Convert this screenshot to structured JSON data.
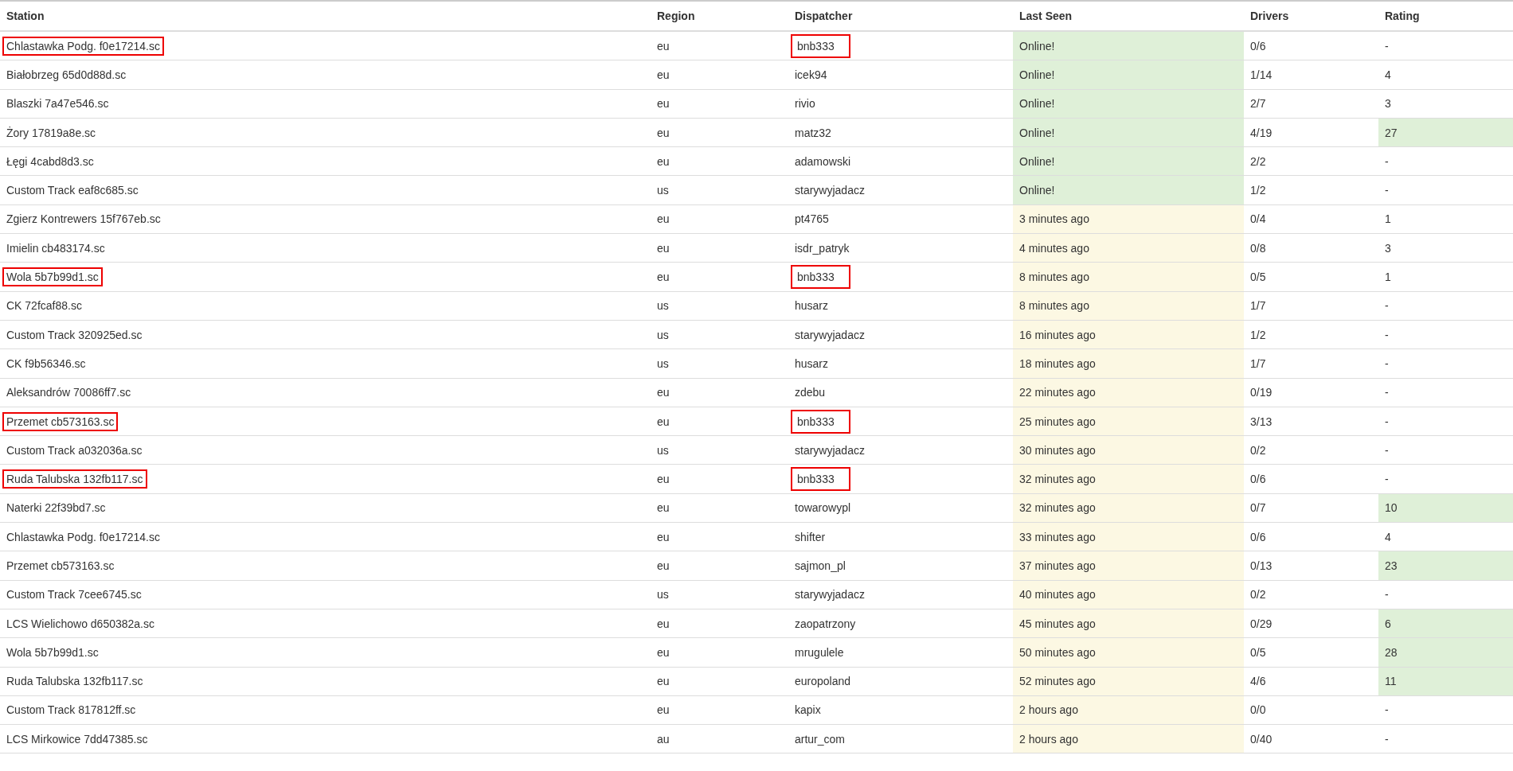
{
  "table": {
    "columns": [
      "Station",
      "Region",
      "Dispatcher",
      "Last Seen",
      "Drivers",
      "Rating"
    ],
    "rows": [
      {
        "station": "Chlastawka Podg. f0e17214.sc",
        "station_marked": true,
        "region": "eu",
        "dispatcher": "bnb333",
        "dispatcher_marked": true,
        "last_seen": "Online!",
        "online": true,
        "drivers": "0/6",
        "rating": "-",
        "rating_highlighted": false
      },
      {
        "station": "Białobrzeg 65d0d88d.sc",
        "station_marked": false,
        "region": "eu",
        "dispatcher": "icek94",
        "dispatcher_marked": false,
        "last_seen": "Online!",
        "online": true,
        "drivers": "1/14",
        "rating": "4",
        "rating_highlighted": false
      },
      {
        "station": "Blaszki 7a47e546.sc",
        "station_marked": false,
        "region": "eu",
        "dispatcher": "rivio",
        "dispatcher_marked": false,
        "last_seen": "Online!",
        "online": true,
        "drivers": "2/7",
        "rating": "3",
        "rating_highlighted": false
      },
      {
        "station": "Żory 17819a8e.sc",
        "station_marked": false,
        "region": "eu",
        "dispatcher": "matz32",
        "dispatcher_marked": false,
        "last_seen": "Online!",
        "online": true,
        "drivers": "4/19",
        "rating": "27",
        "rating_highlighted": true
      },
      {
        "station": "Łęgi 4cabd8d3.sc",
        "station_marked": false,
        "region": "eu",
        "dispatcher": "adamowski",
        "dispatcher_marked": false,
        "last_seen": "Online!",
        "online": true,
        "drivers": "2/2",
        "rating": "-",
        "rating_highlighted": false
      },
      {
        "station": "Custom Track eaf8c685.sc",
        "station_marked": false,
        "region": "us",
        "dispatcher": "starywyjadacz",
        "dispatcher_marked": false,
        "last_seen": "Online!",
        "online": true,
        "drivers": "1/2",
        "rating": "-",
        "rating_highlighted": false
      },
      {
        "station": "Zgierz Kontrewers 15f767eb.sc",
        "station_marked": false,
        "region": "eu",
        "dispatcher": "pt4765",
        "dispatcher_marked": false,
        "last_seen": "3 minutes ago",
        "online": false,
        "drivers": "0/4",
        "rating": "1",
        "rating_highlighted": false
      },
      {
        "station": "Imielin cb483174.sc",
        "station_marked": false,
        "region": "eu",
        "dispatcher": "isdr_patryk",
        "dispatcher_marked": false,
        "last_seen": "4 minutes ago",
        "online": false,
        "drivers": "0/8",
        "rating": "3",
        "rating_highlighted": false
      },
      {
        "station": "Wola 5b7b99d1.sc",
        "station_marked": true,
        "region": "eu",
        "dispatcher": "bnb333",
        "dispatcher_marked": true,
        "last_seen": "8 minutes ago",
        "online": false,
        "drivers": "0/5",
        "rating": "1",
        "rating_highlighted": false
      },
      {
        "station": "CK 72fcaf88.sc",
        "station_marked": false,
        "region": "us",
        "dispatcher": "husarz",
        "dispatcher_marked": false,
        "last_seen": "8 minutes ago",
        "online": false,
        "drivers": "1/7",
        "rating": "-",
        "rating_highlighted": false
      },
      {
        "station": "Custom Track 320925ed.sc",
        "station_marked": false,
        "region": "us",
        "dispatcher": "starywyjadacz",
        "dispatcher_marked": false,
        "last_seen": "16 minutes ago",
        "online": false,
        "drivers": "1/2",
        "rating": "-",
        "rating_highlighted": false
      },
      {
        "station": "CK f9b56346.sc",
        "station_marked": false,
        "region": "us",
        "dispatcher": "husarz",
        "dispatcher_marked": false,
        "last_seen": "18 minutes ago",
        "online": false,
        "drivers": "1/7",
        "rating": "-",
        "rating_highlighted": false
      },
      {
        "station": "Aleksandrów 70086ff7.sc",
        "station_marked": false,
        "region": "eu",
        "dispatcher": "zdebu",
        "dispatcher_marked": false,
        "last_seen": "22 minutes ago",
        "online": false,
        "drivers": "0/19",
        "rating": "-",
        "rating_highlighted": false
      },
      {
        "station": "Przemet cb573163.sc",
        "station_marked": true,
        "region": "eu",
        "dispatcher": "bnb333",
        "dispatcher_marked": true,
        "last_seen": "25 minutes ago",
        "online": false,
        "drivers": "3/13",
        "rating": "-",
        "rating_highlighted": false
      },
      {
        "station": "Custom Track a032036a.sc",
        "station_marked": false,
        "region": "us",
        "dispatcher": "starywyjadacz",
        "dispatcher_marked": false,
        "last_seen": "30 minutes ago",
        "online": false,
        "drivers": "0/2",
        "rating": "-",
        "rating_highlighted": false
      },
      {
        "station": "Ruda Talubska 132fb117.sc",
        "station_marked": true,
        "region": "eu",
        "dispatcher": "bnb333",
        "dispatcher_marked": true,
        "last_seen": "32 minutes ago",
        "online": false,
        "drivers": "0/6",
        "rating": "-",
        "rating_highlighted": false
      },
      {
        "station": "Naterki 22f39bd7.sc",
        "station_marked": false,
        "region": "eu",
        "dispatcher": "towarowypl",
        "dispatcher_marked": false,
        "last_seen": "32 minutes ago",
        "online": false,
        "drivers": "0/7",
        "rating": "10",
        "rating_highlighted": true
      },
      {
        "station": "Chlastawka Podg. f0e17214.sc",
        "station_marked": false,
        "region": "eu",
        "dispatcher": "shifter",
        "dispatcher_marked": false,
        "last_seen": "33 minutes ago",
        "online": false,
        "drivers": "0/6",
        "rating": "4",
        "rating_highlighted": false
      },
      {
        "station": "Przemet cb573163.sc",
        "station_marked": false,
        "region": "eu",
        "dispatcher": "sajmon_pl",
        "dispatcher_marked": false,
        "last_seen": "37 minutes ago",
        "online": false,
        "drivers": "0/13",
        "rating": "23",
        "rating_highlighted": true
      },
      {
        "station": "Custom Track 7cee6745.sc",
        "station_marked": false,
        "region": "us",
        "dispatcher": "starywyjadacz",
        "dispatcher_marked": false,
        "last_seen": "40 minutes ago",
        "online": false,
        "drivers": "0/2",
        "rating": "-",
        "rating_highlighted": false
      },
      {
        "station": "LCS Wielichowo d650382a.sc",
        "station_marked": false,
        "region": "eu",
        "dispatcher": "zaopatrzony",
        "dispatcher_marked": false,
        "last_seen": "45 minutes ago",
        "online": false,
        "drivers": "0/29",
        "rating": "6",
        "rating_highlighted": true
      },
      {
        "station": "Wola 5b7b99d1.sc",
        "station_marked": false,
        "region": "eu",
        "dispatcher": "mrugulele",
        "dispatcher_marked": false,
        "last_seen": "50 minutes ago",
        "online": false,
        "drivers": "0/5",
        "rating": "28",
        "rating_highlighted": true
      },
      {
        "station": "Ruda Talubska 132fb117.sc",
        "station_marked": false,
        "region": "eu",
        "dispatcher": "europoland",
        "dispatcher_marked": false,
        "last_seen": "52 minutes ago",
        "online": false,
        "drivers": "4/6",
        "rating": "11",
        "rating_highlighted": true
      },
      {
        "station": "Custom Track 817812ff.sc",
        "station_marked": false,
        "region": "eu",
        "dispatcher": "kapix",
        "dispatcher_marked": false,
        "last_seen": "2 hours ago",
        "online": false,
        "drivers": "0/0",
        "rating": "-",
        "rating_highlighted": false
      },
      {
        "station": "LCS Mirkowice 7dd47385.sc",
        "station_marked": false,
        "region": "au",
        "dispatcher": "artur_com",
        "dispatcher_marked": false,
        "last_seen": "2 hours ago",
        "online": false,
        "drivers": "0/40",
        "rating": "-",
        "rating_highlighted": false
      }
    ]
  }
}
